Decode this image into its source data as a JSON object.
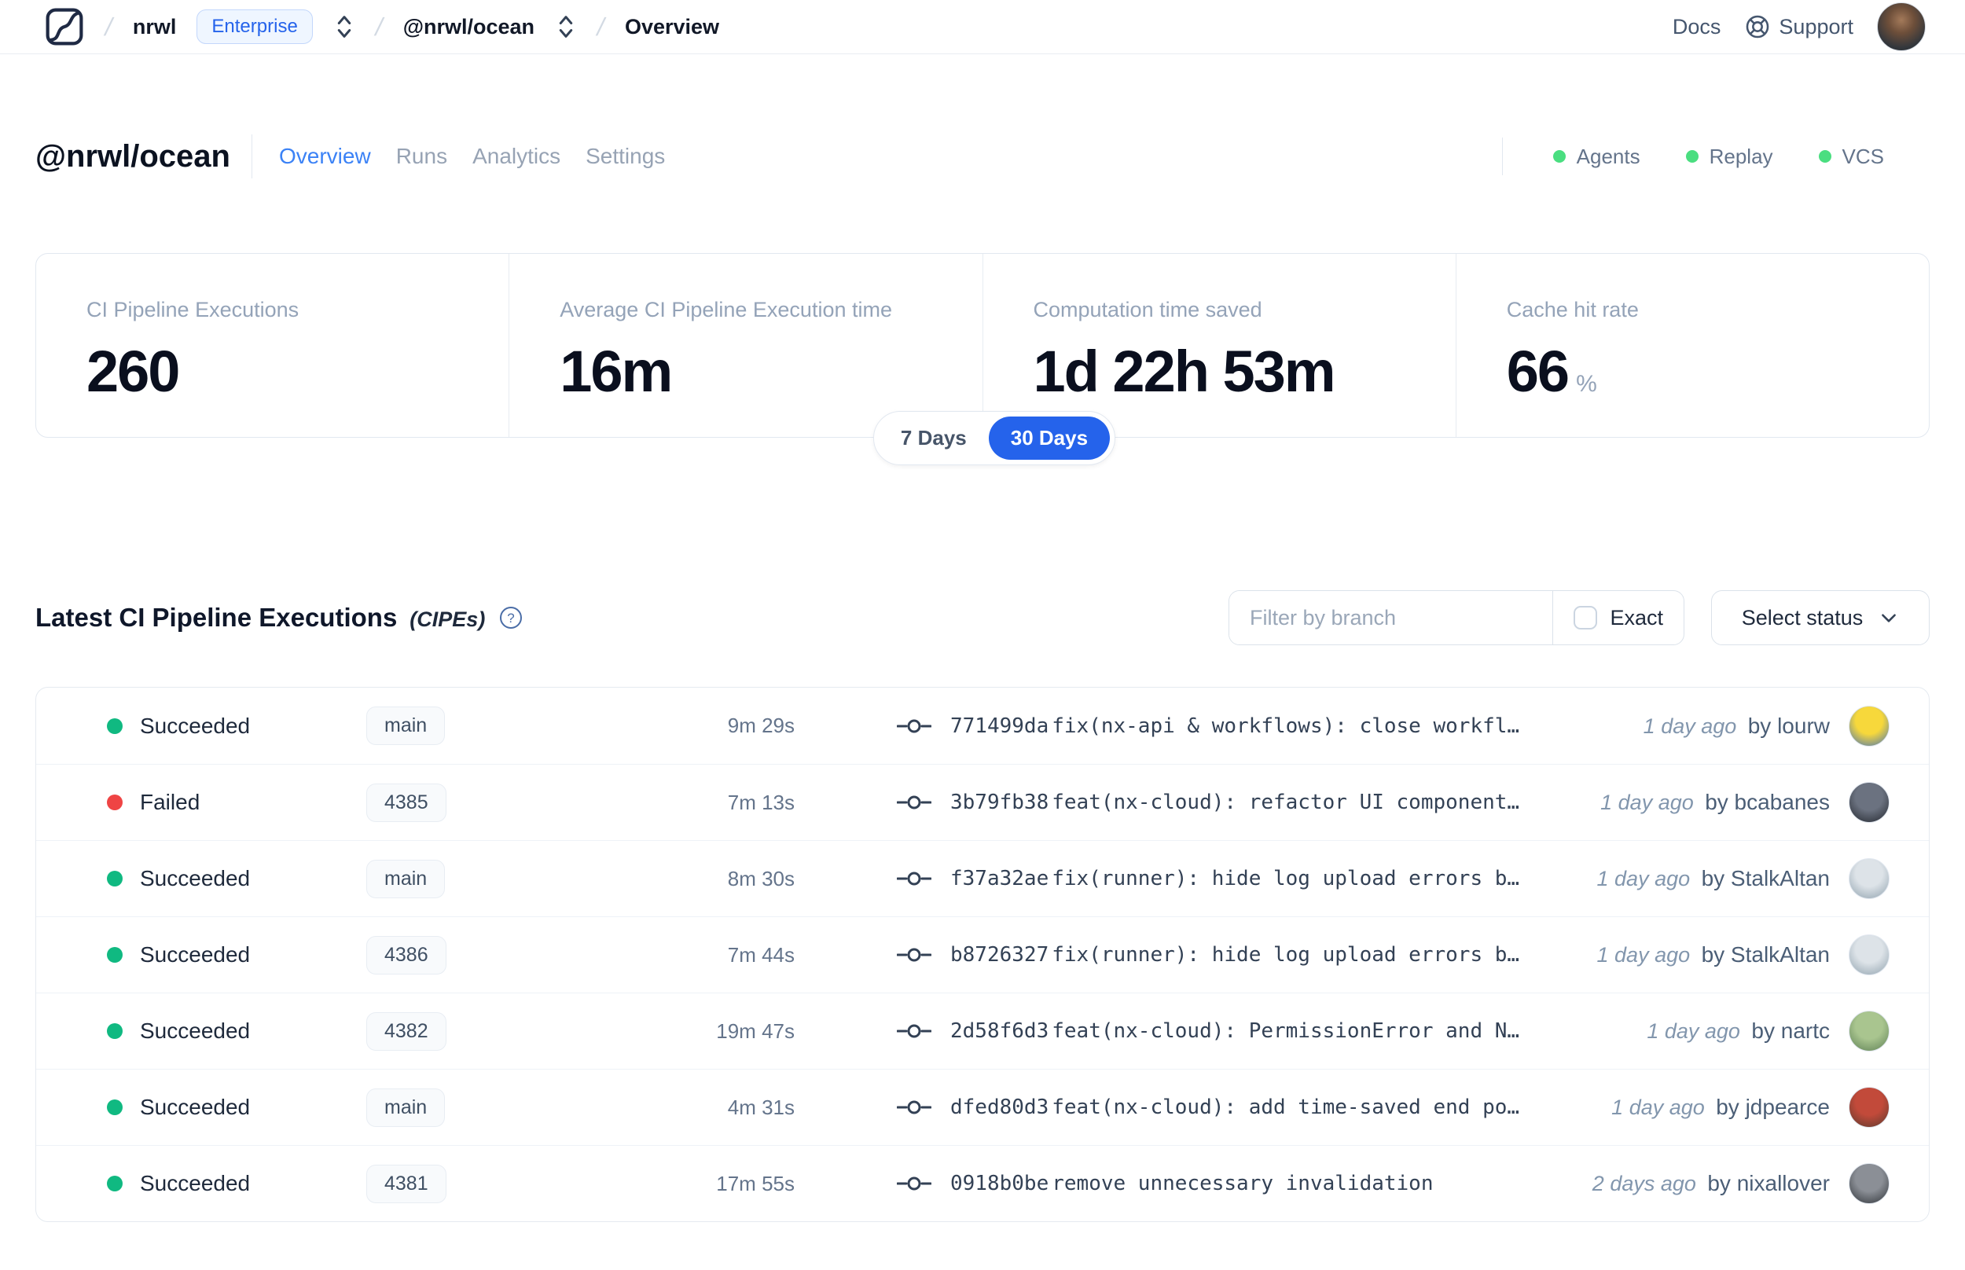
{
  "navbar": {
    "separator": "/",
    "org": "nrwl",
    "org_badge": "Enterprise",
    "workspace": "@nrwl/ocean",
    "page": "Overview",
    "docs_label": "Docs",
    "support_label": "Support"
  },
  "header": {
    "title": "@nrwl/ocean",
    "tabs": [
      {
        "label": "Overview",
        "active": true
      },
      {
        "label": "Runs",
        "active": false
      },
      {
        "label": "Analytics",
        "active": false
      },
      {
        "label": "Settings",
        "active": false
      }
    ],
    "indicators": [
      {
        "label": "Agents",
        "color": "#4ade80"
      },
      {
        "label": "Replay",
        "color": "#4ade80"
      },
      {
        "label": "VCS",
        "color": "#4ade80"
      }
    ]
  },
  "stats": {
    "cards": [
      {
        "label": "CI Pipeline Executions",
        "value": "260",
        "suffix": ""
      },
      {
        "label": "Average CI Pipeline Execution time",
        "value": "16m",
        "suffix": ""
      },
      {
        "label": "Computation time saved",
        "value": "1d 22h 53m",
        "suffix": ""
      },
      {
        "label": "Cache hit rate",
        "value": "66",
        "suffix": "%"
      }
    ],
    "range_toggle": {
      "options": [
        "7 Days",
        "30 Days"
      ],
      "selected": "30 Days"
    }
  },
  "cipe": {
    "title": "Latest CI Pipeline Executions",
    "title_suffix": "(CIPEs)",
    "filter_placeholder": "Filter by branch",
    "exact_label": "Exact",
    "exact_checked": false,
    "status_dropdown_label": "Select status"
  },
  "table": {
    "author_prefix": "by",
    "rows": [
      {
        "status": "Succeeded",
        "status_color": "#10b981",
        "branch": "main",
        "duration": "9m 29s",
        "commit_hash": "771499da",
        "commit_message": "fix(nx-api & workflows): close workfl…",
        "time_ago": "1 day ago",
        "author": "lourw",
        "avatar": {
          "from": "#f7d83b",
          "to": "#4472b8"
        }
      },
      {
        "status": "Failed",
        "status_color": "#ef4444",
        "branch": "4385",
        "duration": "7m 13s",
        "commit_hash": "3b79fb38",
        "commit_message": "feat(nx-cloud): refactor UI component…",
        "time_ago": "1 day ago",
        "author": "bcabanes",
        "avatar": {
          "from": "#6b7280",
          "to": "#23272e"
        }
      },
      {
        "status": "Succeeded",
        "status_color": "#10b981",
        "branch": "main",
        "duration": "8m 30s",
        "commit_hash": "f37a32ae",
        "commit_message": "fix(runner): hide log upload errors b…",
        "time_ago": "1 day ago",
        "author": "StalkAltan",
        "avatar": {
          "from": "#dde3e8",
          "to": "#8fa1ad"
        }
      },
      {
        "status": "Succeeded",
        "status_color": "#10b981",
        "branch": "4386",
        "duration": "7m 44s",
        "commit_hash": "b8726327",
        "commit_message": "fix(runner): hide log upload errors b…",
        "time_ago": "1 day ago",
        "author": "StalkAltan",
        "avatar": {
          "from": "#dde3e8",
          "to": "#8fa1ad"
        }
      },
      {
        "status": "Succeeded",
        "status_color": "#10b981",
        "branch": "4382",
        "duration": "19m 47s",
        "commit_hash": "2d58f6d3",
        "commit_message": "feat(nx-cloud): PermissionError and N…",
        "time_ago": "1 day ago",
        "author": "nartc",
        "avatar": {
          "from": "#a9c58f",
          "to": "#5d7f54"
        }
      },
      {
        "status": "Succeeded",
        "status_color": "#10b981",
        "branch": "main",
        "duration": "4m 31s",
        "commit_hash": "dfed80d3",
        "commit_message": "feat(nx-cloud): add time-saved end po…",
        "time_ago": "1 day ago",
        "author": "jdpearce",
        "avatar": {
          "from": "#c24a3a",
          "to": "#5a3a2e"
        }
      },
      {
        "status": "Succeeded",
        "status_color": "#10b981",
        "branch": "4381",
        "duration": "17m 55s",
        "commit_hash": "0918b0be",
        "commit_message": "remove unnecessary invalidation",
        "time_ago": "2 days ago",
        "author": "nixallover",
        "avatar": {
          "from": "#8b8f96",
          "to": "#2f3338"
        }
      }
    ]
  },
  "colors": {
    "accent_blue": "#2563eb",
    "tab_active_blue": "#3b82f6",
    "success_green": "#10b981",
    "failed_red": "#ef4444",
    "indicator_green": "#4ade80"
  }
}
